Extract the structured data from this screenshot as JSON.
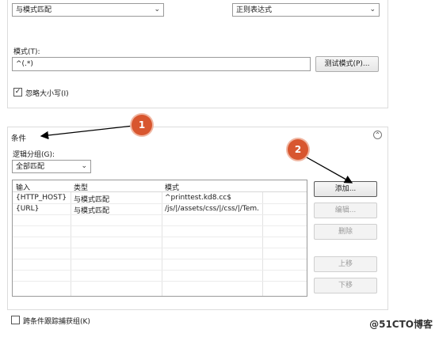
{
  "top": {
    "requested_url_select": "与模式匹配",
    "using_select": "正则表达式",
    "pattern_label": "模式(T):",
    "pattern_value": "^(.*)",
    "test_pattern_button": "测试模式(P)...",
    "ignore_case_label": "忽略大小写(I)",
    "ignore_case_checked": true
  },
  "conditions": {
    "title": "条件",
    "logical_grouping_label": "逻辑分组(G):",
    "logical_grouping_value": "全部匹配",
    "columns": [
      "输入",
      "类型",
      "模式"
    ],
    "rows": [
      {
        "input": "{HTTP_HOST}",
        "type": "与模式匹配",
        "pattern": "^printtest.kd8.cc$"
      },
      {
        "input": "{URL}",
        "type": "与模式匹配",
        "pattern": "/js/|/assets/css/|/css/|/Tem..."
      }
    ],
    "buttons": {
      "add": "添加...",
      "edit": "编辑...",
      "delete": "删除",
      "move_up": "上移",
      "move_down": "下移"
    },
    "track_groups_label": "跨条件跟踪捕获组(K)",
    "track_groups_checked": false
  },
  "callouts": [
    "1",
    "2"
  ],
  "watermark": "@51CTO博客",
  "colors": {
    "callout": "#d8562f",
    "arrow": "#000000"
  }
}
